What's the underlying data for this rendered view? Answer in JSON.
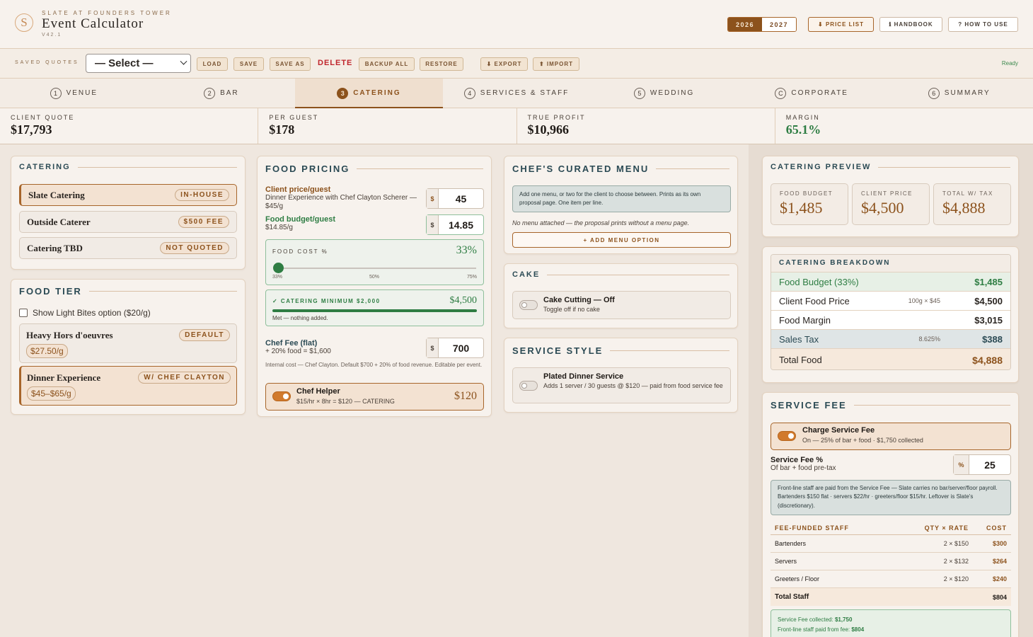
{
  "header": {
    "eyebrow": "SLATE AT FOUNDERS TOWER",
    "title": "Event Calculator",
    "version": "V42.1",
    "logo_letter": "S",
    "years": [
      "2026",
      "2027"
    ],
    "active_year": "2026",
    "buttons": {
      "price_list": "⬇ PRICE LIST",
      "handbook": "ℹ HANDBOOK",
      "how_to_use": "? HOW TO USE"
    }
  },
  "toolbar": {
    "label": "SAVED QUOTES",
    "select_value": "— Select —",
    "load": "LOAD",
    "save": "SAVE",
    "save_as": "SAVE AS",
    "delete": "DELETE",
    "backup_all": "BACKUP ALL",
    "restore": "RESTORE",
    "export": "⬇ EXPORT",
    "import": "⬆ IMPORT",
    "status": "Ready"
  },
  "tabs": [
    {
      "num": "1",
      "label": "VENUE"
    },
    {
      "num": "2",
      "label": "BAR"
    },
    {
      "num": "3",
      "label": "CATERING"
    },
    {
      "num": "4",
      "label": "SERVICES & STAFF"
    },
    {
      "num": "5",
      "label": "WEDDING"
    },
    {
      "num": "C",
      "label": "CORPORATE"
    },
    {
      "num": "6",
      "label": "SUMMARY"
    }
  ],
  "active_tab": "CATERING",
  "kpis": [
    {
      "label": "CLIENT QUOTE",
      "value": "$17,793"
    },
    {
      "label": "PER GUEST",
      "value": "$178"
    },
    {
      "label": "TRUE PROFIT",
      "value": "$10,966"
    },
    {
      "label": "MARGIN",
      "value": "65.1%"
    }
  ],
  "catering": {
    "title": "CATERING",
    "options": [
      {
        "name": "Slate Catering",
        "badge": "IN-HOUSE",
        "selected": true
      },
      {
        "name": "Outside Caterer",
        "badge": "$500 FEE",
        "selected": false
      },
      {
        "name": "Catering TBD",
        "badge": "NOT QUOTED",
        "selected": false
      }
    ]
  },
  "food_tier": {
    "title": "FOOD TIER",
    "light_bites_label": "Show Light Bites option ($20/g)",
    "tiers": [
      {
        "name": "Heavy Hors d'oeuvres",
        "badge": "DEFAULT",
        "price": "$27.50/g",
        "selected": false
      },
      {
        "name": "Dinner Experience",
        "badge": "W/ CHEF CLAYTON",
        "price": "$45–$65/g",
        "selected": true
      }
    ]
  },
  "food_pricing": {
    "title": "FOOD PRICING",
    "client_price_label": "Client price/guest",
    "client_price_sub": "Dinner Experience with Chef Clayton Scherer — $45/g",
    "client_price_value": "45",
    "budget_label": "Food budget/guest",
    "budget_sub": "$14.85/g",
    "budget_value": "14.85",
    "currency": "$",
    "food_cost_label": "FOOD COST %",
    "food_cost_value": "33%",
    "food_cost_fraction": 0.0,
    "slider_ticks": [
      "33%",
      "50%",
      "75%"
    ],
    "minimum_label": "✓ CATERING MINIMUM $2,000",
    "minimum_value": "$4,500",
    "minimum_note": "Met — nothing added.",
    "chef_fee_label": "Chef Fee (flat)",
    "chef_fee_sub": "+ 20% food = $1,600",
    "chef_fee_value": "700",
    "chef_fee_note": "Internal cost — Chef Clayton. Default $700 + 20% of food revenue. Editable per event.",
    "chef_helper_title": "Chef Helper",
    "chef_helper_desc": "$15/hr × 8hr = $120 — CATERING",
    "chef_helper_value": "$120"
  },
  "chefs_menu": {
    "title": "CHEF'S CURATED MENU",
    "info": "Add one menu, or two for the client to choose between. Prints as its own proposal page. One item per line.",
    "empty_note": "No menu attached — the proposal prints without a menu page.",
    "add_button": "+ ADD MENU OPTION"
  },
  "cake": {
    "title": "CAKE",
    "toggle_title": "Cake Cutting — Off",
    "toggle_desc": "Toggle off if no cake"
  },
  "service_style": {
    "title": "SERVICE STYLE",
    "toggle_title": "Plated Dinner Service",
    "toggle_desc": "Adds 1 server / 30 guests @ $120 — paid from food service fee"
  },
  "preview": {
    "title": "CATERING PREVIEW",
    "cards": [
      {
        "label": "FOOD BUDGET",
        "value": "$1,485"
      },
      {
        "label": "CLIENT PRICE",
        "value": "$4,500"
      },
      {
        "label": "TOTAL W/ TAX",
        "value": "$4,888"
      }
    ]
  },
  "breakdown": {
    "title": "CATERING BREAKDOWN",
    "rows": [
      {
        "label": "Food Budget (33%)",
        "meta": "",
        "value": "$1,485"
      },
      {
        "label": "Client Food Price",
        "meta": "100g × $45",
        "value": "$4,500"
      },
      {
        "label": "Food Margin",
        "meta": "",
        "value": "$3,015"
      },
      {
        "label": "Sales Tax",
        "meta": "8.625%",
        "value": "$388"
      },
      {
        "label": "Total Food",
        "meta": "",
        "value": "$4,888"
      }
    ]
  },
  "service_fee": {
    "title": "SERVICE FEE",
    "toggle_title": "Charge Service Fee",
    "toggle_desc": "On — 25% of bar + food · $1,750 collected",
    "pct_label": "Service Fee %",
    "pct_sub": "Of bar + food pre-tax",
    "pct_prefix": "%",
    "pct_value": "25",
    "info": "Front-line staff are paid from the Service Fee — Slate carries no bar/server/floor payroll. Bartenders $150 flat · servers $22/hr · greeters/floor $15/hr. Leftover is Slate's (discretionary).",
    "table_headers": [
      "FEE-FUNDED STAFF",
      "QTY × RATE",
      "COST"
    ],
    "staff": [
      {
        "name": "Bartenders",
        "qty": "2 × $150",
        "cost": "$300"
      },
      {
        "name": "Servers",
        "qty": "2 × $132",
        "cost": "$264"
      },
      {
        "name": "Greeters / Floor",
        "qty": "2 × $120",
        "cost": "$240"
      }
    ],
    "total_label": "Total Staff",
    "total_value": "$804",
    "collected_label": "Service Fee collected:",
    "collected_value": "$1,750",
    "paid_label": "Front-line staff paid from fee:",
    "paid_value": "$804"
  }
}
